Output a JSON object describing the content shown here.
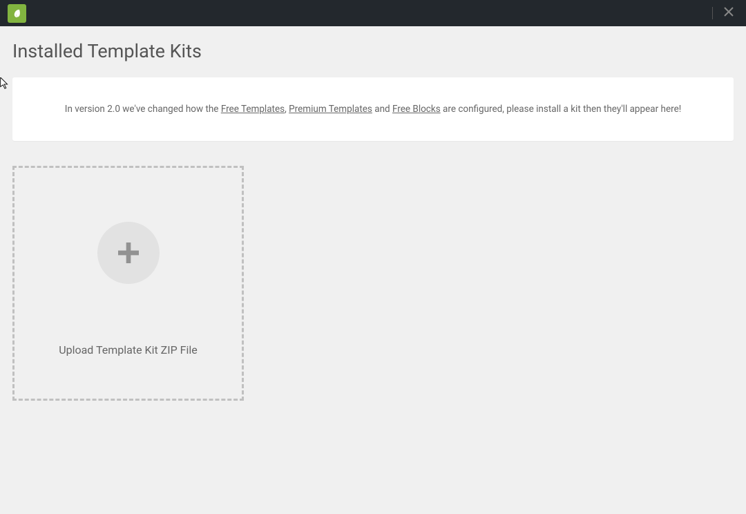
{
  "page": {
    "title": "Installed Template Kits"
  },
  "notice": {
    "prefix": "In version 2.0 we've changed how the ",
    "link1": "Free Templates",
    "sep1": ", ",
    "link2": "Premium Templates",
    "sep2": " and ",
    "link3": "Free Blocks",
    "suffix": " are configured, please install a kit then they'll appear here!"
  },
  "upload": {
    "label": "Upload Template Kit ZIP File"
  }
}
